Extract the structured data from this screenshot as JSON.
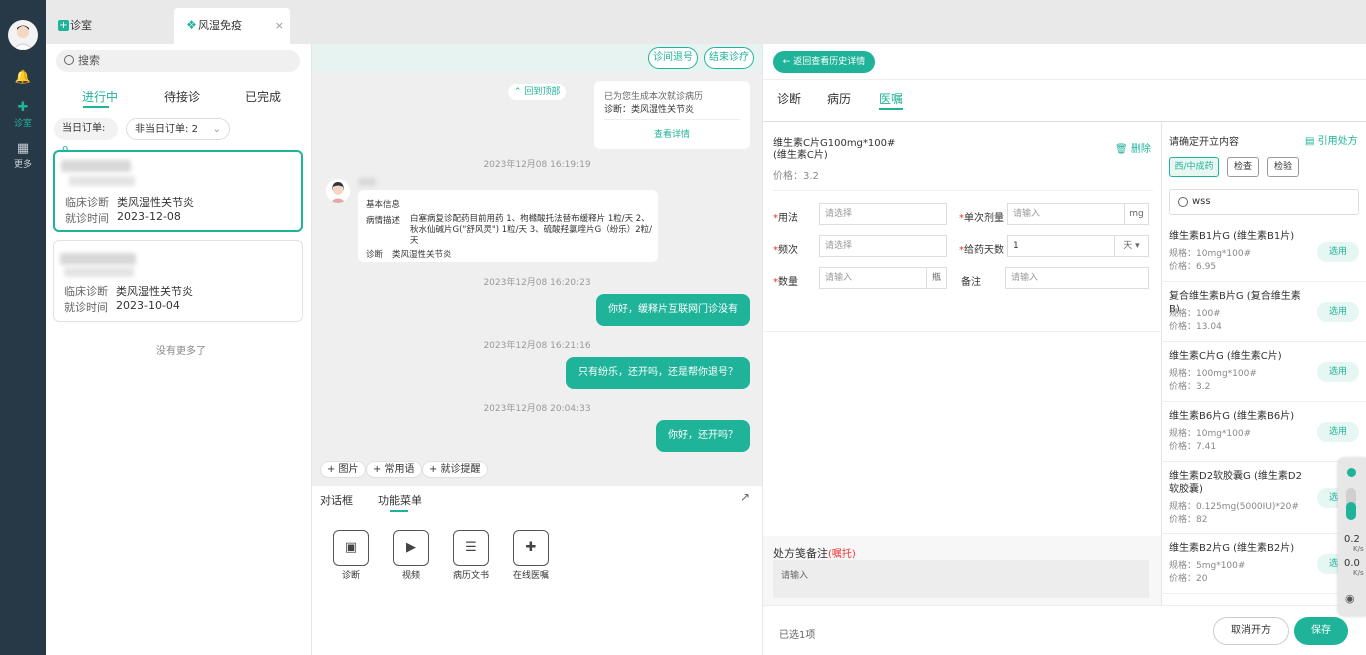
{
  "nav": {
    "items": [
      {
        "label": "诊室"
      },
      {
        "label": "更多"
      }
    ]
  },
  "tabs": [
    {
      "label": "诊室"
    },
    {
      "label": "风湿免疫"
    }
  ],
  "left": {
    "search_placeholder": "搜索",
    "patient_tabs": [
      "进行中",
      "待接诊",
      "已完成"
    ],
    "today_orders_label": "当日订单:",
    "today_orders_count": "0",
    "other_orders_label": "非当日订单:",
    "other_orders_count": "2",
    "cards": [
      {
        "diag_label": "临床诊断",
        "diag": "类风湿性关节炎",
        "time_label": "就诊时间",
        "time": "2023-12-08"
      },
      {
        "diag_label": "临床诊断",
        "diag": "类风湿性关节炎",
        "time_label": "就诊时间",
        "time": "2023-10-04"
      }
    ],
    "no_more": "没有更多了"
  },
  "chat": {
    "btn_refund": "诊间退号",
    "btn_end": "结束诊疗",
    "back_top": "回到顶部",
    "record_card": {
      "line1": "已为您生成本次就诊病历",
      "line2": "诊断：类风湿性关节炎",
      "link": "查看详情"
    },
    "ts1": "2023年12月08 16:19:19",
    "info": {
      "title": "基本信息",
      "desc_label": "病情描述",
      "desc": "白塞病复诊配药目前用药 1、枸橼酸托法替布缓释片 1粒/天 2、 秋水仙碱片G(\"舒风灵\") 1粒/天 3、硫酸羟氯喹片G（纷乐）2粒/天",
      "diag_label": "诊断",
      "diag": "类风湿性关节炎"
    },
    "ts2": "2023年12月08 16:20:23",
    "msg1": "你好，缓释片互联网门诊没有",
    "ts3": "2023年12月08 16:21:16",
    "msg2": "只有纷乐，还开吗，还是帮你退号？",
    "ts4": "2023年12月08 20:04:33",
    "msg3": "你好，还开吗？",
    "tools": [
      "+ 图片",
      "+ 常用语",
      "+ 就诊提醒"
    ],
    "panel_tabs": [
      "对话框",
      "功能菜单"
    ],
    "funcs": [
      "诊断",
      "视频",
      "病历文书",
      "在线医嘱"
    ]
  },
  "rx": {
    "back_btn": "← 返回查看历史详情",
    "tabs": [
      "诊断",
      "病历",
      "医嘱"
    ],
    "drug_title": "维生素C片G100mg*100#",
    "drug_sub": "(维生素C片)",
    "delete": "删除",
    "price": "价格：3.2",
    "f_usage": "用法",
    "f_usage_ph": "请选择",
    "f_dose": "单次剂量",
    "f_dose_ph": "请输入",
    "f_dose_unit": "mg",
    "f_freq": "频次",
    "f_freq_ph": "请选择",
    "f_days": "给药天数",
    "f_days_val": "1",
    "f_days_unit": "天",
    "f_qty": "数量",
    "f_qty_ph": "请输入",
    "f_qty_unit": "瓶",
    "f_note": "备注",
    "f_note_ph": "请输入",
    "remark_title": "处方笺备注",
    "remark_tag": "(嘱托)",
    "remark_ph": "请输入",
    "selected": "已选1项",
    "cancel": "取消开方",
    "save": "保存"
  },
  "druglist": {
    "title": "请确定开立内容",
    "cite": "引用处方",
    "cats": [
      "西/中成药",
      "检查",
      "检验"
    ],
    "search": "wss",
    "use_label": "选用",
    "items": [
      {
        "name": "维生素B1片G (维生素B1片)",
        "spec": "规格：10mg*100#",
        "price": "价格：6.95"
      },
      {
        "name": "复合维生素B片G (复合维生素B)",
        "spec": "规格：100#",
        "price": "价格：13.04"
      },
      {
        "name": "维生素C片G (维生素C片)",
        "spec": "规格：100mg*100#",
        "price": "价格：3.2"
      },
      {
        "name": "维生素B6片G (维生素B6片)",
        "spec": "规格：10mg*100#",
        "price": "价格：7.41"
      },
      {
        "name": "维生素D2软胶囊G (维生素D2软胶囊)",
        "spec": "规格：0.125mg(5000IU)*20#",
        "price": "价格：82"
      },
      {
        "name": "维生素B2片G (维生素B2片)",
        "spec": "规格：5mg*100#",
        "price": "价格：20"
      }
    ]
  },
  "speed": {
    "up": "0.2",
    "down": "0.0",
    "unit": "K/s"
  }
}
